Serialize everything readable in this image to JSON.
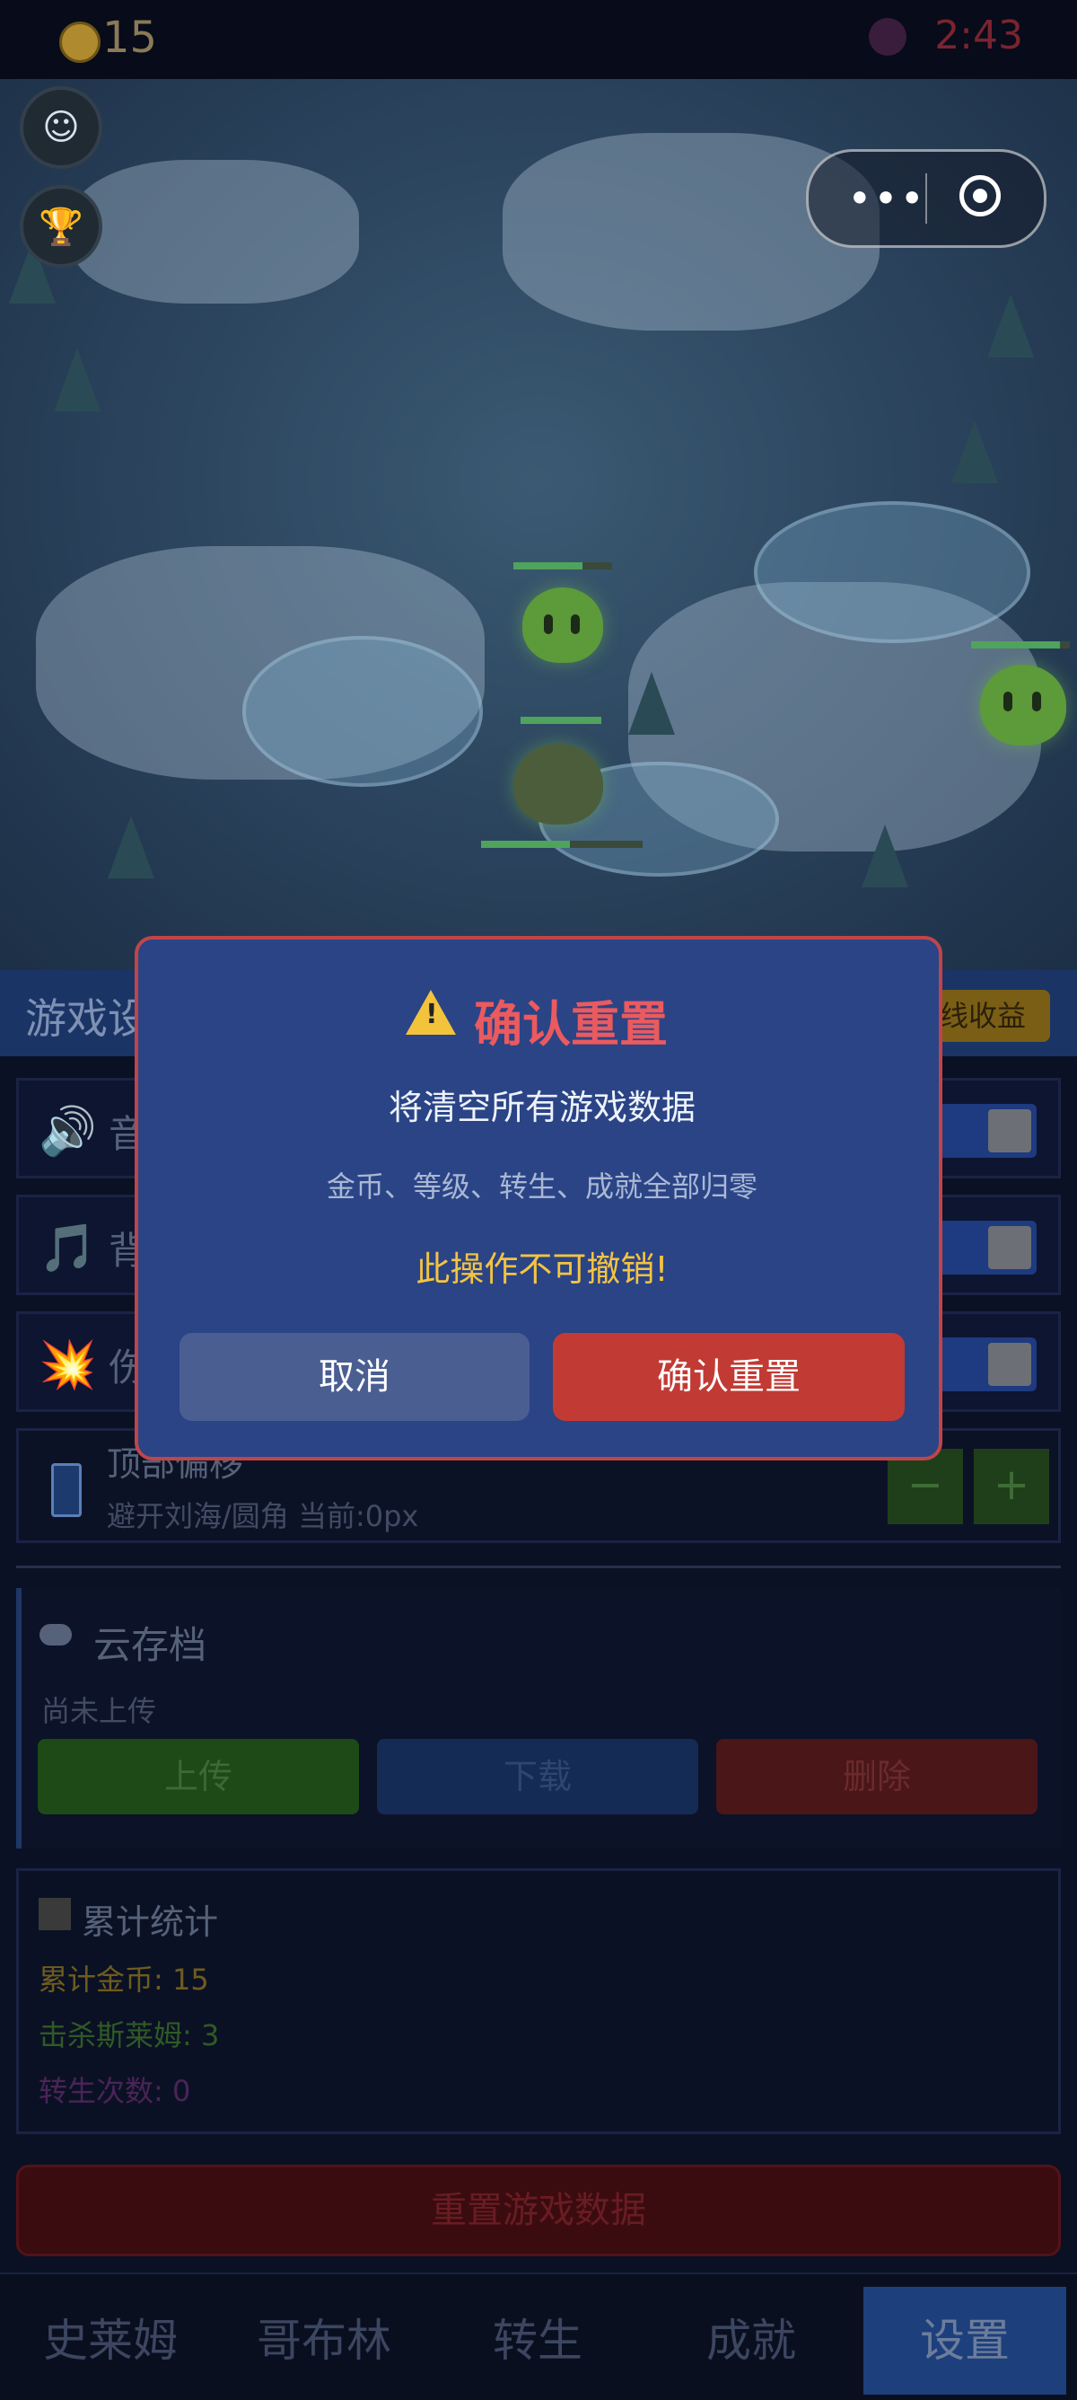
{
  "status": {
    "coins": "15",
    "time": "2:43"
  },
  "map": {
    "slimes": 3,
    "capsule_dots": "•••"
  },
  "panel": {
    "title": "游戏设置",
    "offline_label": "线收益",
    "settings": [
      {
        "icon": "speaker-icon",
        "glyph": "🔊",
        "label": "音效"
      },
      {
        "icon": "music-icon",
        "glyph": "🎵",
        "label": "背景音乐"
      },
      {
        "icon": "damage-burst-icon",
        "glyph": "💥",
        "label": "伤害数字"
      }
    ],
    "offset": {
      "title": "顶部偏移",
      "desc": "避开刘海/圆角  当前:0px",
      "minus": "−",
      "plus": "+"
    },
    "cloud": {
      "title": "云存档",
      "status": "尚未上传",
      "upload": "上传",
      "download": "下载",
      "delete": "删除"
    },
    "stats": {
      "title": "累计统计",
      "coins": "累计金币: 15",
      "kills": "击杀斯莱姆: 3",
      "rebirths": "转生次数: 0"
    },
    "reset_label": "重置游戏数据"
  },
  "tabs": [
    "史莱姆",
    "哥布林",
    "转生",
    "成就",
    "设置"
  ],
  "dialog": {
    "title": "确认重置",
    "message": "将清空所有游戏数据",
    "detail": "金币、等级、转生、成就全部归零",
    "warning": "此操作不可撤销!",
    "cancel": "取消",
    "confirm": "确认重置"
  },
  "colors": {
    "accent_red": "#c23a34",
    "dialog_bg": "#2a4486",
    "warning": "#f4c342"
  }
}
